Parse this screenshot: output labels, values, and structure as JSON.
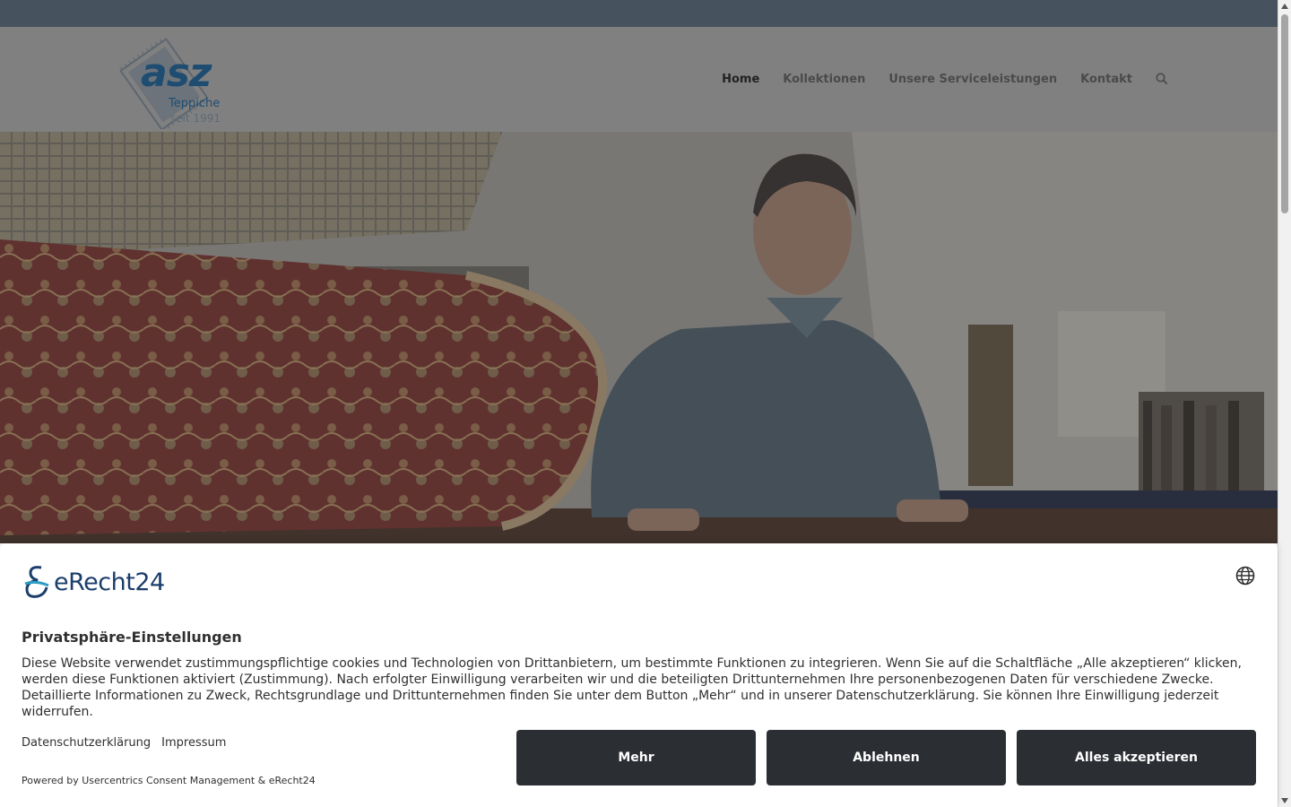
{
  "header": {
    "logo": {
      "name": "asz",
      "subtitle": "Teppiche",
      "since": "seit 1991"
    },
    "nav": [
      {
        "label": "Home",
        "active": true
      },
      {
        "label": "Kollektionen",
        "active": false
      },
      {
        "label": "Unsere Serviceleistungen",
        "active": false
      },
      {
        "label": "Kontakt",
        "active": false
      }
    ],
    "search_icon": "search-icon"
  },
  "hero": {
    "image": "man-in-rug-showroom-photo"
  },
  "consent": {
    "brand": "eRecht24",
    "language_icon": "globe-icon",
    "title": "Privatsphäre-Einstellungen",
    "text": "Diese Website verwendet zustimmungspflichtige cookies und Technologien von Drittanbietern, um bestimmte Funktionen zu integrieren. Wenn Sie auf die Schaltfläche „Alle akzeptieren“ klicken, werden diese Funktionen aktiviert (Zustimmung). Nach erfolgter Einwilligung verarbeiten wir und die beteiligten Drittunternehmen Ihre personenbezogenen Daten für verschiedene Zwecke. Detaillierte Informationen zu Zweck, Rechtsgrundlage und Drittunternehmen finden Sie unter dem Button „Mehr“ und in unserer Datenschutzerklärung. Sie können Ihre Einwilligung jederzeit widerrufen.",
    "links": {
      "privacy": "Datenschutzerklärung",
      "imprint": "Impressum"
    },
    "powered_by": "Powered by Usercentrics Consent Management & eRecht24",
    "buttons": {
      "more": "Mehr",
      "deny": "Ablehnen",
      "accept": "Alles akzeptieren"
    }
  },
  "colors": {
    "topbar": "#46525e",
    "header_overlay": "#808080",
    "button_bg": "#2b2e33",
    "brand_blue": "#1b3e6b"
  }
}
